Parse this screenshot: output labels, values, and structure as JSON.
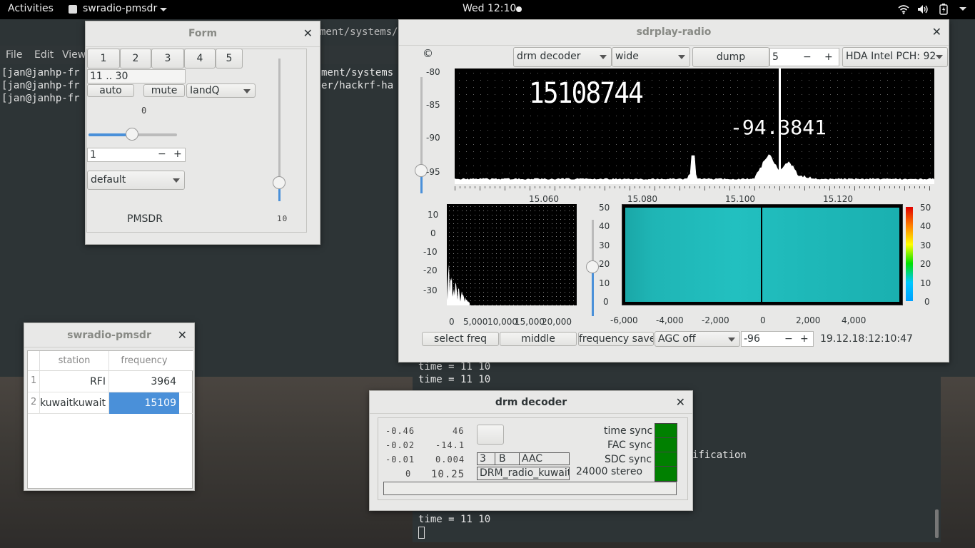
{
  "topbar": {
    "activities": "Activities",
    "app_menu": "swradio-pmsdr",
    "clock": "Wed 12:10"
  },
  "terminal": {
    "menu": [
      "File",
      "Edit",
      "View"
    ],
    "path_fragment": "ment/systems/qt",
    "lines": [
      "[jan@janhp-fr",
      "[jan@janhp-fr",
      "[jan@janhp-fr"
    ],
    "line_tails": [
      "ment/systems",
      "er/hackrf-ha"
    ],
    "lower_lines": [
      "time = 11 10",
      "time = 11 10",
      "time = 11 10"
    ],
    "side_text": "ification"
  },
  "form_window": {
    "title": "Form",
    "band_buttons": [
      "1",
      "2",
      "3",
      "4",
      "5"
    ],
    "range_field": "11 .. 30",
    "auto_label": "auto",
    "mute_label": "mute",
    "iq_combo": "IandQ",
    "small_lcd": "0",
    "spin_value": "1",
    "profile_combo": "default",
    "device_label": "PMSDR",
    "slider_lcd": "10"
  },
  "sdrplay_window": {
    "title": "sdrplay-radio",
    "copyright_icon": "©",
    "decoder_combo": "drm decoder",
    "width_combo": "wide",
    "dump_button": "dump",
    "spin_value": "5",
    "audio_combo": "HDA Intel PCH: 92",
    "freq_display": "15108744",
    "level_display": "-94.3841",
    "spectrum_y_ticks": [
      "-80",
      "-85",
      "-90",
      "-95"
    ],
    "spectrum_x_ticks": [
      "15.060",
      "15.080",
      "15.100",
      "15.120"
    ],
    "hist_y_ticks": [
      "10",
      "0",
      "-10",
      "-20",
      "-30"
    ],
    "hist_x_ticks": [
      "0",
      "5,000",
      "10,000",
      "15,000",
      "20,000"
    ],
    "wf_y_ticks": [
      "50",
      "40",
      "30",
      "20",
      "10",
      "0"
    ],
    "wf_x_ticks": [
      "-6,000",
      "-4,000",
      "-2,000",
      "0",
      "2,000",
      "4,000"
    ],
    "colorbar_ticks": [
      "50",
      "40",
      "30",
      "20",
      "10",
      "0"
    ],
    "select_freq_button": "select freq",
    "middle_button": "middle",
    "freq_save_button": "frequency save",
    "agc_combo": "AGC off",
    "agc_value": "-96",
    "timestamp": "19.12.18:12:10:47"
  },
  "stations_window": {
    "title": "swradio-pmsdr",
    "columns": [
      "station",
      "frequency"
    ],
    "rows": [
      {
        "num": "1",
        "station": "RFI",
        "frequency": "3964"
      },
      {
        "num": "2",
        "station": "kuwaitkuwait",
        "frequency": "15109"
      }
    ]
  },
  "drm_window": {
    "title": "drm decoder",
    "lcd_left": [
      "-0.46",
      "-0.02",
      "-0.01",
      "0"
    ],
    "lcd_right": [
      "46",
      "-14.1",
      "0.004",
      "10.25"
    ],
    "mode_cells": [
      "3",
      "B",
      "AAC"
    ],
    "station_name": "DRM_radio_kuwait",
    "audio_info": "24000 stereo",
    "sync_labels": [
      "time sync",
      "FAC sync",
      "SDC sync"
    ],
    "sync_color": "#008000"
  }
}
